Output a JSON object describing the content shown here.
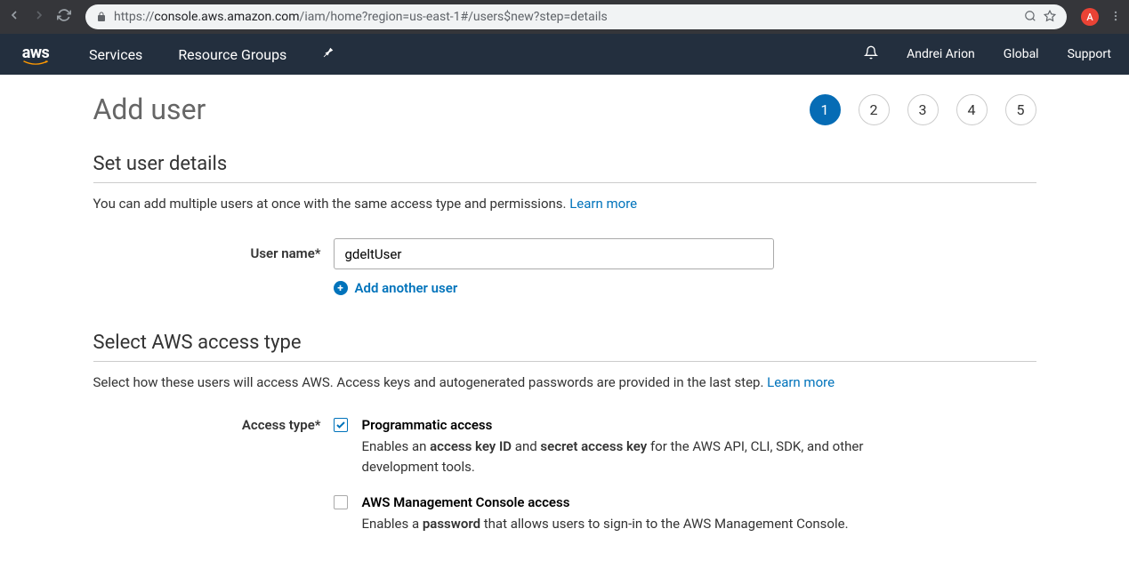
{
  "browser": {
    "url_prefix": "https://",
    "url_domain": "console.aws.amazon.com",
    "url_path": "/iam/home?region=us-east-1#/users$new?step=details",
    "profile_letter": "A"
  },
  "nav": {
    "services": "Services",
    "resource_groups": "Resource Groups",
    "user": "Andrei Arion",
    "region": "Global",
    "support": "Support"
  },
  "page": {
    "title": "Add user",
    "steps": [
      "1",
      "2",
      "3",
      "4",
      "5"
    ],
    "active_step": 0
  },
  "section1": {
    "heading": "Set user details",
    "description": "You can add multiple users at once with the same access type and permissions.",
    "learn_more": "Learn more",
    "username_label": "User name*",
    "username_value": "gdeltUser",
    "add_another": "Add another user"
  },
  "section2": {
    "heading": "Select AWS access type",
    "description": "Select how these users will access AWS. Access keys and autogenerated passwords are provided in the last step.",
    "learn_more": "Learn more",
    "access_type_label": "Access type*",
    "options": [
      {
        "title": "Programmatic access",
        "checked": true,
        "desc_pre": "Enables an ",
        "desc_b1": "access key ID",
        "desc_mid": " and ",
        "desc_b2": "secret access key",
        "desc_post": " for the AWS API, CLI, SDK, and other development tools."
      },
      {
        "title": "AWS Management Console access",
        "checked": false,
        "desc_pre": "Enables a ",
        "desc_b1": "password",
        "desc_mid": "",
        "desc_b2": "",
        "desc_post": " that allows users to sign-in to the AWS Management Console."
      }
    ]
  }
}
